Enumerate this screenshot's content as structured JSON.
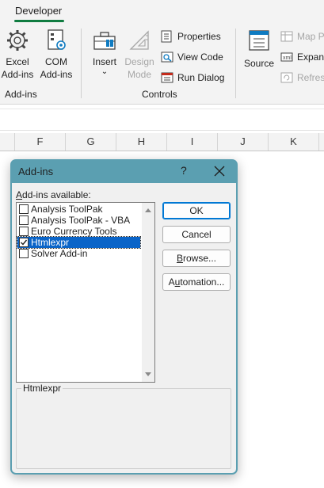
{
  "ribbon": {
    "active_tab": "Developer",
    "groups": {
      "addins": {
        "label": "Add-ins",
        "excel_addins": [
          "Excel",
          "Add-ins"
        ],
        "com_addins": [
          "COM",
          "Add-ins"
        ]
      },
      "controls": {
        "label": "Controls",
        "insert": "Insert",
        "insert_arrow": "⌄",
        "design_mode": [
          "Design",
          "Mode"
        ],
        "properties": "Properties",
        "view_code": "View Code",
        "run_dialog": "Run Dialog"
      },
      "xml": {
        "source": "Source",
        "map_properties": "Map P",
        "expansion_packs": "Expans",
        "refresh_data": "Refresh"
      }
    }
  },
  "sheet": {
    "columns": [
      "F",
      "G",
      "H",
      "I",
      "J",
      "K"
    ]
  },
  "dialog": {
    "title": "Add-ins",
    "help": "?",
    "available_label_prefix": "A",
    "available_label_rest": "dd-ins available:",
    "addins": [
      {
        "name": "Analysis ToolPak",
        "checked": false,
        "selected": false
      },
      {
        "name": "Analysis ToolPak - VBA",
        "checked": false,
        "selected": false
      },
      {
        "name": "Euro Currency Tools",
        "checked": false,
        "selected": false
      },
      {
        "name": "Htmlexpr",
        "checked": true,
        "selected": true
      },
      {
        "name": "Solver Add-in",
        "checked": false,
        "selected": false
      }
    ],
    "buttons": {
      "ok": "OK",
      "cancel": "Cancel",
      "browse_prefix": "",
      "browse_key": "B",
      "browse_rest": "rowse...",
      "automation_prefix": "A",
      "automation_key": "u",
      "automation_rest": "tomation..."
    },
    "description_title": "Htmlexpr",
    "colors": {
      "title_bar": "#5b9fb1",
      "selection": "#0a64c8",
      "accent_underline": "#107c41"
    }
  }
}
